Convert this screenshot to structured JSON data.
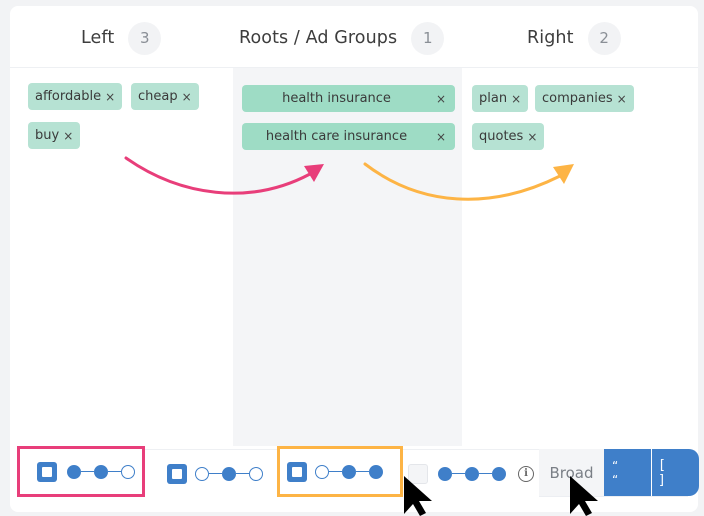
{
  "columns": {
    "left": {
      "title": "Left",
      "count": "3",
      "chips": [
        {
          "label": "affordable",
          "remove": "×"
        },
        {
          "label": "cheap",
          "remove": "×"
        },
        {
          "label": "buy",
          "remove": "×"
        }
      ]
    },
    "middle": {
      "title": "Roots / Ad Groups",
      "count": "1",
      "chips": [
        {
          "label": "health insurance",
          "remove": "×"
        },
        {
          "label": "health care insurance",
          "remove": "×"
        }
      ]
    },
    "right": {
      "title": "Right",
      "count": "2",
      "chips": [
        {
          "label": "plan",
          "remove": "×"
        },
        {
          "label": "companies",
          "remove": "×"
        },
        {
          "label": "quotes",
          "remove": "×"
        }
      ]
    }
  },
  "arrows": {
    "left_to_root_color": "#e83e7a",
    "root_to_right_color": "#fdb445"
  },
  "toolbar": {
    "combos": [
      {
        "name": "left-root",
        "checked": true,
        "pattern": [
          true,
          true,
          false
        ],
        "highlight": "#e83e7a"
      },
      {
        "name": "root-only",
        "checked": true,
        "pattern": [
          false,
          true,
          false
        ],
        "highlight": null
      },
      {
        "name": "root-right",
        "checked": true,
        "pattern": [
          false,
          true,
          true
        ],
        "highlight": "#fdb445"
      },
      {
        "name": "all",
        "checked": false,
        "pattern": [
          true,
          true,
          true
        ],
        "highlight": null
      }
    ],
    "info_icon": "i",
    "match_types": {
      "broad": "Broad",
      "phrase": "“ “",
      "exact": "[ ]"
    }
  },
  "colors": {
    "chip": "#b6e2d3",
    "root_chip": "#9edcc5",
    "accent_blue": "#3f7fc9"
  }
}
